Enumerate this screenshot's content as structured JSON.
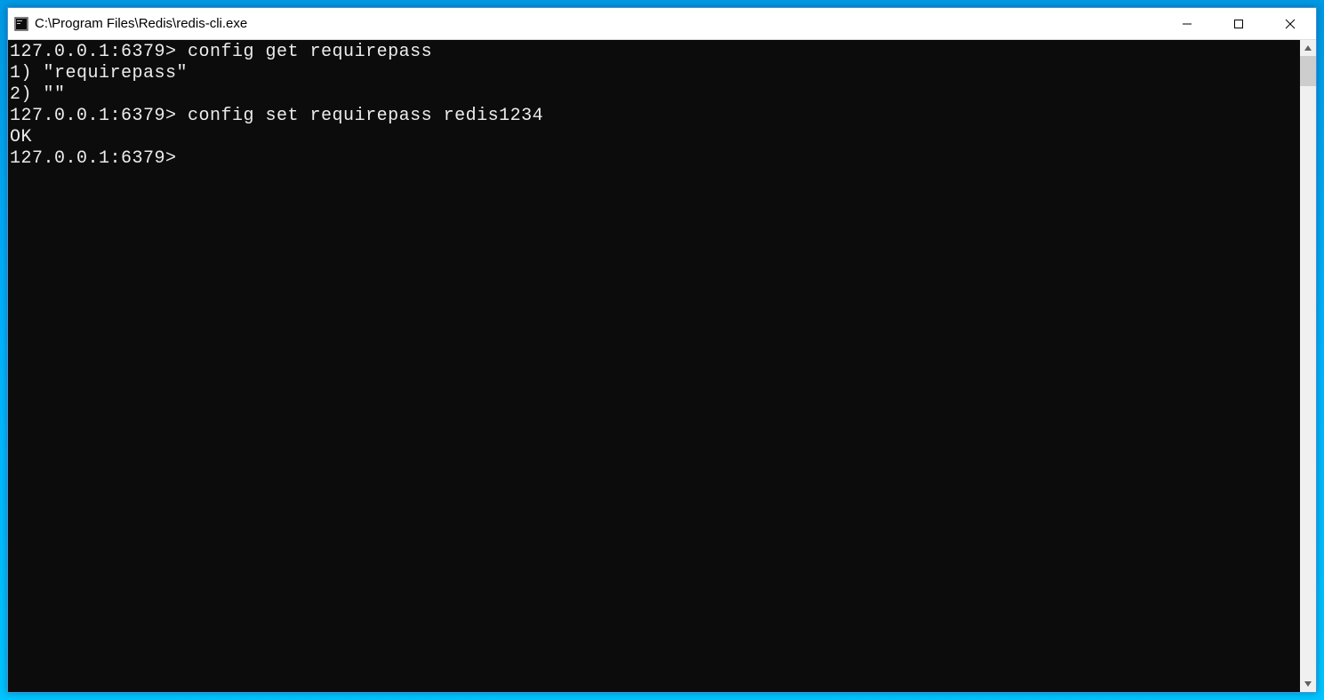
{
  "window": {
    "title": "C:\\Program Files\\Redis\\redis-cli.exe"
  },
  "terminal": {
    "lines": [
      {
        "prompt": "127.0.0.1:6379>",
        "command": " config get requirepass"
      },
      {
        "output": "1) \"requirepass\""
      },
      {
        "output": "2) \"\""
      },
      {
        "prompt": "127.0.0.1:6379>",
        "command": " config set requirepass redis1234"
      },
      {
        "output": "OK"
      },
      {
        "prompt": "127.0.0.1:6379>",
        "command": ""
      }
    ]
  }
}
